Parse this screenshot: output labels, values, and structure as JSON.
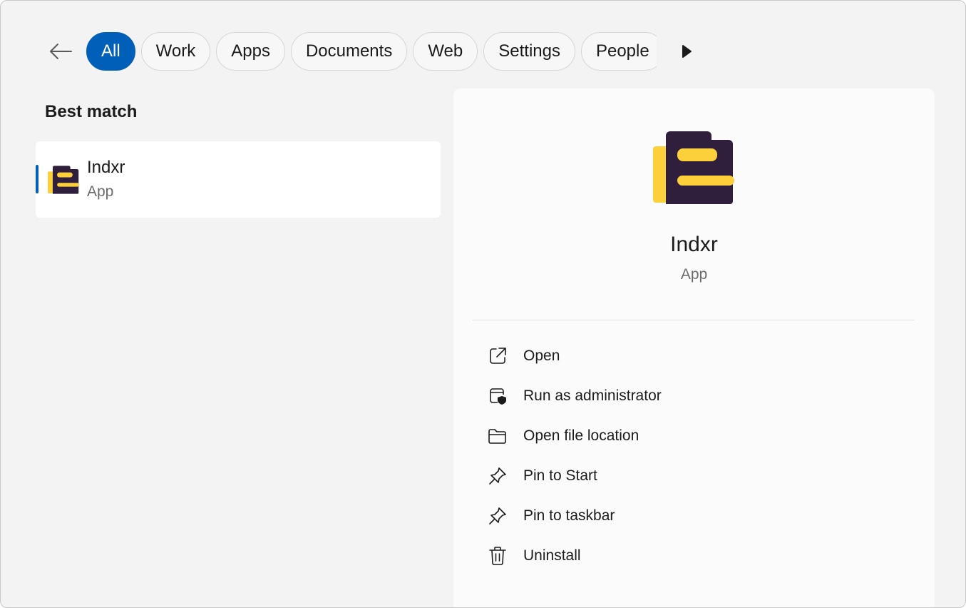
{
  "filters": {
    "chips": [
      {
        "label": "All",
        "active": true
      },
      {
        "label": "Work",
        "active": false
      },
      {
        "label": "Apps",
        "active": false
      },
      {
        "label": "Documents",
        "active": false
      },
      {
        "label": "Web",
        "active": false
      },
      {
        "label": "Settings",
        "active": false
      },
      {
        "label": "People",
        "active": false
      }
    ]
  },
  "results": {
    "section_title": "Best match",
    "best_match": {
      "name": "Indxr",
      "type": "App",
      "icon": "indxr-app-icon"
    }
  },
  "detail": {
    "name": "Indxr",
    "type": "App",
    "actions": [
      {
        "label": "Open",
        "icon": "open-external-icon"
      },
      {
        "label": "Run as administrator",
        "icon": "admin-shield-icon"
      },
      {
        "label": "Open file location",
        "icon": "folder-icon"
      },
      {
        "label": "Pin to Start",
        "icon": "pin-icon"
      },
      {
        "label": "Pin to taskbar",
        "icon": "pin-icon"
      },
      {
        "label": "Uninstall",
        "icon": "trash-icon"
      }
    ]
  },
  "colors": {
    "accent": "#005fb8",
    "icon_dark": "#2f1f3d",
    "icon_yellow": "#fcd03a"
  }
}
